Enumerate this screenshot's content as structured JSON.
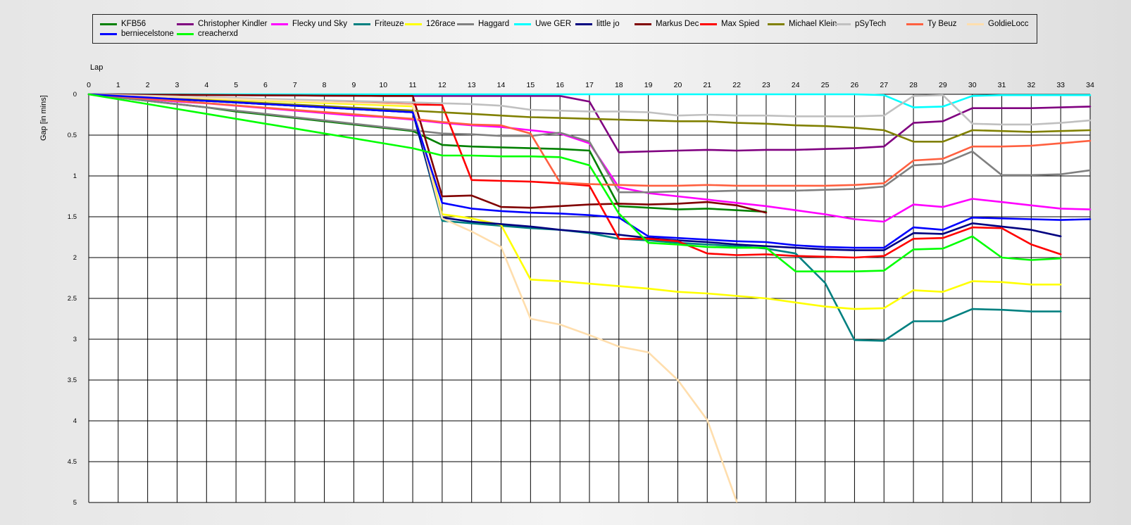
{
  "chart_data": {
    "type": "line",
    "title": "",
    "xlabel": "Lap",
    "ylabel": "Gap [in mins]",
    "x": [
      0,
      1,
      2,
      3,
      4,
      5,
      6,
      7,
      8,
      9,
      10,
      11,
      12,
      13,
      14,
      15,
      16,
      17,
      18,
      19,
      20,
      21,
      22,
      23,
      24,
      25,
      26,
      27,
      28,
      29,
      30,
      31,
      32,
      33,
      34
    ],
    "xlim": [
      0,
      34
    ],
    "ylim": [
      0,
      5
    ],
    "y_inverted": true,
    "yticks": [
      "0",
      "0.5",
      "1",
      "1.5",
      "2",
      "2.5",
      "3",
      "3.5",
      "4",
      "4.5",
      "5"
    ],
    "grid": true,
    "legend_position": "top",
    "series": [
      {
        "name": "KFB56",
        "color": "#008000",
        "values": [
          0,
          0.04,
          0.08,
          0.12,
          0.16,
          0.21,
          0.25,
          0.29,
          0.33,
          0.37,
          0.41,
          0.45,
          0.62,
          0.64,
          0.65,
          0.66,
          0.67,
          0.69,
          1.37,
          1.39,
          1.41,
          1.4,
          1.42,
          1.44
        ]
      },
      {
        "name": "Christopher Kindler",
        "color": "#800080",
        "values": [
          0,
          0.002,
          0.004,
          0.006,
          0.008,
          0.01,
          0.012,
          0.014,
          0.016,
          0.018,
          0.02,
          0.02,
          0.02,
          0.02,
          0.02,
          0.02,
          0.02,
          0.09,
          0.71,
          0.7,
          0.69,
          0.68,
          0.69,
          0.68,
          0.68,
          0.67,
          0.66,
          0.64,
          0.35,
          0.33,
          0.17,
          0.17,
          0.17,
          0.16,
          0.15
        ]
      },
      {
        "name": "Flecky und Sky",
        "color": "#ff00ff",
        "values": [
          0,
          0.03,
          0.06,
          0.09,
          0.11,
          0.14,
          0.17,
          0.2,
          0.23,
          0.26,
          0.28,
          0.31,
          0.35,
          0.38,
          0.4,
          0.44,
          0.48,
          0.6,
          1.14,
          1.21,
          1.25,
          1.29,
          1.33,
          1.37,
          1.42,
          1.47,
          1.53,
          1.56,
          1.35,
          1.38,
          1.28,
          1.32,
          1.36,
          1.4,
          1.41
        ]
      },
      {
        "name": "Friteuze",
        "color": "#008080",
        "values": [
          0,
          0.02,
          0.04,
          0.06,
          0.08,
          0.1,
          0.12,
          0.14,
          0.16,
          0.18,
          0.2,
          0.22,
          1.55,
          1.58,
          1.61,
          1.64,
          1.66,
          1.7,
          1.77,
          1.79,
          1.82,
          1.84,
          1.86,
          1.89,
          1.95,
          2.31,
          3.01,
          3.02,
          2.78,
          2.78,
          2.63,
          2.64,
          2.66,
          2.66
        ]
      },
      {
        "name": "126race",
        "color": "#ffff00",
        "values": [
          0,
          0.013,
          0.027,
          0.04,
          0.053,
          0.067,
          0.08,
          0.093,
          0.107,
          0.12,
          0.133,
          0.147,
          1.47,
          1.52,
          1.6,
          2.27,
          2.29,
          2.32,
          2.35,
          2.38,
          2.42,
          2.44,
          2.47,
          2.5,
          2.55,
          2.6,
          2.63,
          2.62,
          2.4,
          2.42,
          2.29,
          2.3,
          2.33,
          2.33
        ]
      },
      {
        "name": "Haggard",
        "color": "#808080",
        "values": [
          0,
          0.04,
          0.08,
          0.12,
          0.16,
          0.2,
          0.24,
          0.28,
          0.32,
          0.36,
          0.4,
          0.44,
          0.48,
          0.49,
          0.51,
          0.51,
          0.47,
          0.58,
          1.2,
          1.2,
          1.19,
          1.19,
          1.18,
          1.18,
          1.18,
          1.17,
          1.16,
          1.13,
          0.87,
          0.85,
          0.7,
          0.99,
          0.99,
          0.98,
          0.93
        ]
      },
      {
        "name": "Uwe GER",
        "color": "#00ffff",
        "values": [
          0,
          0,
          0,
          0,
          0,
          0,
          0,
          0,
          0,
          0,
          0,
          0,
          0,
          0,
          0,
          0,
          0,
          0,
          0,
          0,
          0,
          0,
          0,
          0,
          0,
          0,
          0,
          0.01,
          0.16,
          0.15,
          0.02,
          0.01,
          0.01,
          0.01,
          0.01
        ]
      },
      {
        "name": "little jo",
        "color": "#000080",
        "values": [
          0,
          0.02,
          0.04,
          0.06,
          0.08,
          0.1,
          0.12,
          0.14,
          0.16,
          0.18,
          0.2,
          0.22,
          1.51,
          1.56,
          1.59,
          1.62,
          1.66,
          1.69,
          1.72,
          1.76,
          1.79,
          1.81,
          1.84,
          1.86,
          1.88,
          1.9,
          1.91,
          1.91,
          1.7,
          1.71,
          1.58,
          1.62,
          1.66,
          1.74
        ]
      },
      {
        "name": "Markus Dec",
        "color": "#800000",
        "values": [
          0,
          0.002,
          0.004,
          0.006,
          0.008,
          0.01,
          0.012,
          0.014,
          0.016,
          0.018,
          0.02,
          0.02,
          1.25,
          1.24,
          1.38,
          1.39,
          1.37,
          1.35,
          1.34,
          1.35,
          1.34,
          1.32,
          1.36,
          1.45
        ]
      },
      {
        "name": "Max Spied",
        "color": "#ff0000",
        "values": [
          0,
          0.011,
          0.023,
          0.034,
          0.045,
          0.057,
          0.068,
          0.079,
          0.091,
          0.102,
          0.113,
          0.125,
          0.13,
          1.05,
          1.06,
          1.07,
          1.09,
          1.12,
          1.77,
          1.77,
          1.8,
          1.95,
          1.97,
          1.96,
          1.98,
          1.99,
          2.0,
          1.98,
          1.77,
          1.76,
          1.63,
          1.64,
          1.84,
          1.96
        ]
      },
      {
        "name": "Michael Klein",
        "color": "#808000",
        "values": [
          0,
          0.018,
          0.036,
          0.055,
          0.073,
          0.091,
          0.109,
          0.127,
          0.145,
          0.164,
          0.182,
          0.2,
          0.22,
          0.24,
          0.26,
          0.28,
          0.29,
          0.3,
          0.31,
          0.32,
          0.33,
          0.33,
          0.35,
          0.36,
          0.38,
          0.39,
          0.41,
          0.44,
          0.58,
          0.58,
          0.44,
          0.45,
          0.46,
          0.45,
          0.44
        ]
      },
      {
        "name": "pSyTech",
        "color": "#c0c0c0",
        "values": [
          0,
          0.009,
          0.018,
          0.027,
          0.036,
          0.045,
          0.055,
          0.064,
          0.073,
          0.082,
          0.091,
          0.1,
          0.11,
          0.12,
          0.14,
          0.19,
          0.2,
          0.21,
          0.21,
          0.22,
          0.26,
          0.25,
          0.26,
          0.26,
          0.27,
          0.27,
          0.27,
          0.26,
          0.02,
          0.01,
          0.36,
          0.37,
          0.37,
          0.35,
          0.32
        ]
      },
      {
        "name": "Ty Beuz",
        "color": "#ff6040",
        "values": [
          0,
          0.027,
          0.055,
          0.082,
          0.109,
          0.136,
          0.164,
          0.191,
          0.218,
          0.245,
          0.273,
          0.3,
          0.34,
          0.37,
          0.38,
          0.48,
          1.08,
          1.1,
          1.11,
          1.12,
          1.12,
          1.11,
          1.12,
          1.12,
          1.12,
          1.12,
          1.11,
          1.09,
          0.81,
          0.79,
          0.64,
          0.64,
          0.63,
          0.6,
          0.57
        ]
      },
      {
        "name": "GoldieLocc",
        "color": "#ffdead",
        "values": [
          0,
          0.012,
          0.024,
          0.035,
          0.047,
          0.059,
          0.071,
          0.083,
          0.095,
          0.106,
          0.118,
          0.13,
          1.52,
          1.68,
          1.87,
          2.75,
          2.82,
          2.95,
          3.09,
          3.16,
          3.5,
          3.99,
          4.99
        ]
      },
      {
        "name": "berniecelstone",
        "color": "#0000ff",
        "values": [
          0,
          0.02,
          0.04,
          0.06,
          0.08,
          0.1,
          0.12,
          0.14,
          0.16,
          0.18,
          0.2,
          0.22,
          1.33,
          1.4,
          1.43,
          1.45,
          1.46,
          1.48,
          1.51,
          1.74,
          1.76,
          1.78,
          1.8,
          1.81,
          1.85,
          1.87,
          1.88,
          1.88,
          1.63,
          1.66,
          1.51,
          1.52,
          1.53,
          1.54,
          1.53
        ]
      },
      {
        "name": "creacherxd",
        "color": "#00ff00",
        "values": [
          0,
          0.06,
          0.12,
          0.18,
          0.24,
          0.3,
          0.36,
          0.42,
          0.48,
          0.54,
          0.6,
          0.66,
          0.75,
          0.75,
          0.76,
          0.76,
          0.77,
          0.87,
          1.46,
          1.82,
          1.84,
          1.87,
          1.88,
          1.88,
          2.17,
          2.17,
          2.17,
          2.16,
          1.9,
          1.89,
          1.74,
          2.0,
          2.03,
          2.01
        ]
      }
    ]
  }
}
